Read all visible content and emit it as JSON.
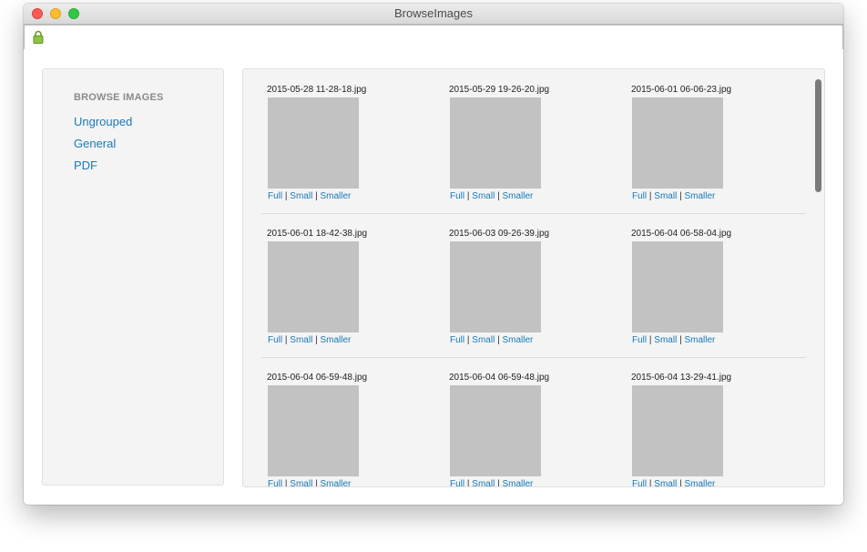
{
  "window": {
    "title": "BrowseImages",
    "controls": [
      "close",
      "minimize",
      "zoom"
    ],
    "address_icon": "lock-icon"
  },
  "sidebar": {
    "heading": "BROWSE IMAGES",
    "items": [
      {
        "label": "Ungrouped"
      },
      {
        "label": "General"
      },
      {
        "label": "PDF"
      }
    ]
  },
  "gallery": {
    "link_labels": {
      "full": "Full",
      "small": "Small",
      "smaller": "Smaller",
      "separator": "|"
    },
    "rows": [
      [
        "2015-05-28 11-28-18.jpg",
        "2015-05-29 19-26-20.jpg",
        "2015-06-01 06-06-23.jpg"
      ],
      [
        "2015-06-01 18-42-38.jpg",
        "2015-06-03 09-26-39.jpg",
        "2015-06-04 06-58-04.jpg"
      ],
      [
        "2015-06-04 06-59-48.jpg",
        "2015-06-04 06-59-48.jpg",
        "2015-06-04 13-29-41.jpg"
      ]
    ]
  },
  "colors": {
    "link": "#1a7ab8",
    "thumbnail_placeholder": "#c2c2c2",
    "panel_background": "#f4f4f4"
  }
}
